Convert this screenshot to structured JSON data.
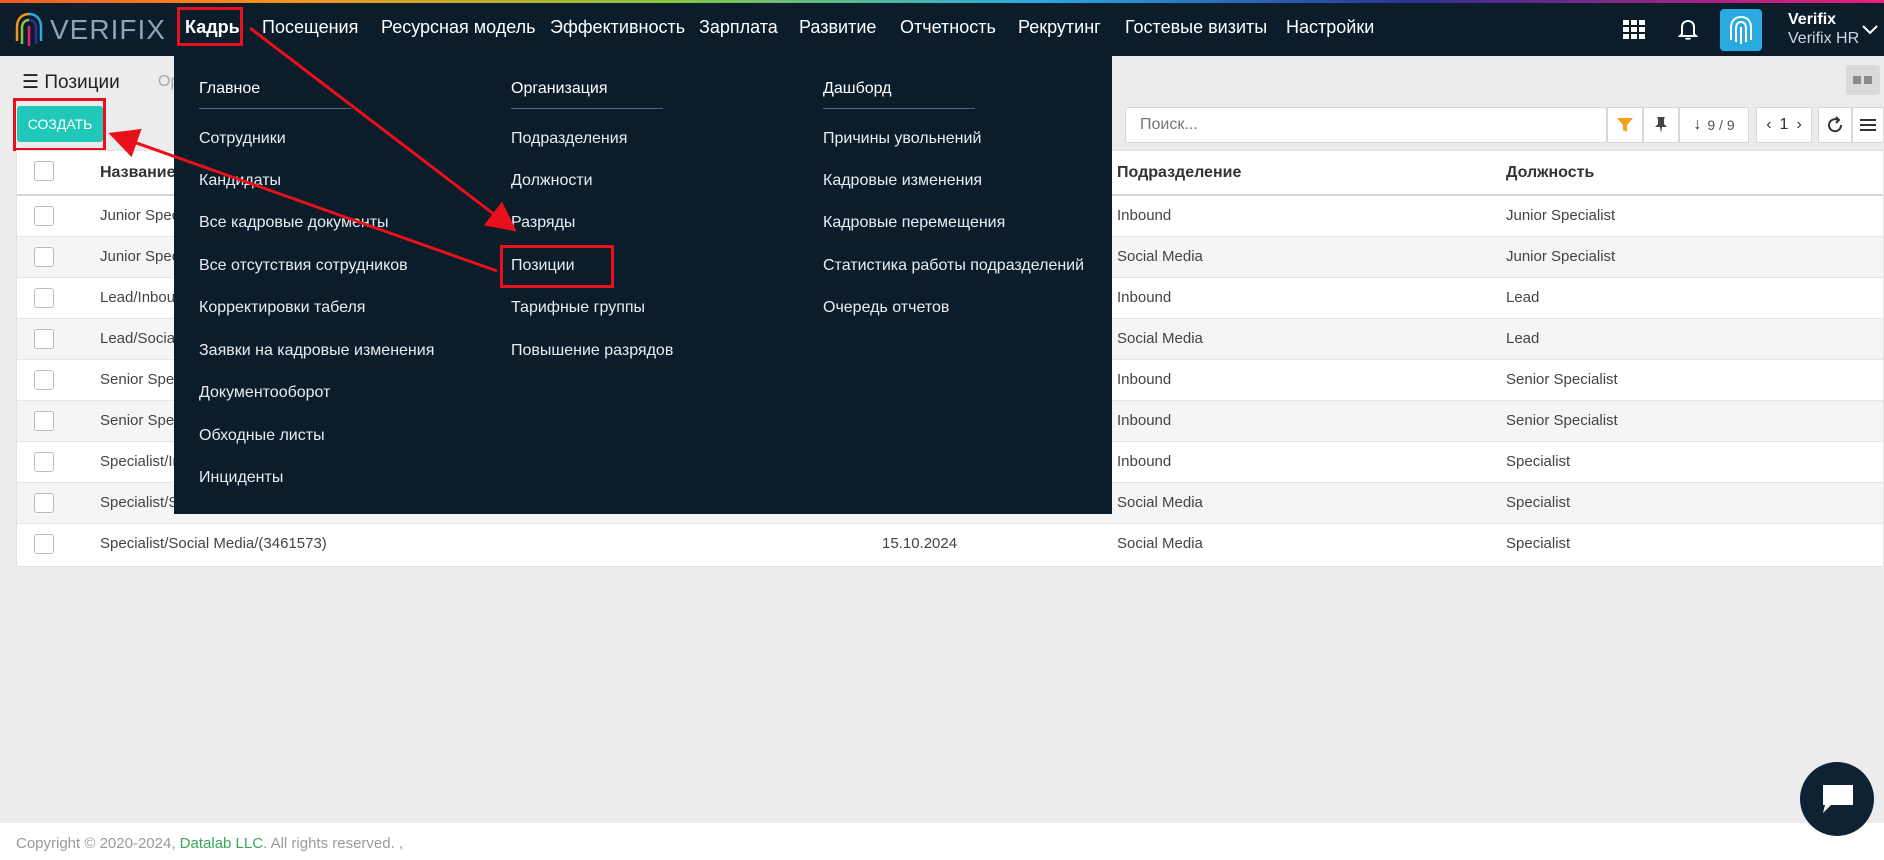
{
  "brand": {
    "name": "VERIFIX"
  },
  "nav": {
    "items": [
      "Кадры",
      "Посещения",
      "Ресурсная модель",
      "Эффективность",
      "Зарплата",
      "Развитие",
      "Отчетность",
      "Рекрутинг",
      "Гостевые визиты",
      "Настройки"
    ],
    "user_name": "Verifix",
    "user_company": "Verifix HR",
    "icons": [
      "apps-grid-icon",
      "bell-icon",
      "fingerprint-icon",
      "chevron-down-icon"
    ]
  },
  "page": {
    "title": "Позиции",
    "breadcrumb_partial": "Ор"
  },
  "toolbar": {
    "create_label": "СОЗДАТЬ",
    "search_placeholder": "Поиск...",
    "record_count": "9 / 9",
    "page_number": "1"
  },
  "table": {
    "headers": {
      "name": "Название",
      "division": "Подразделение",
      "job": "Должность"
    },
    "rows": [
      {
        "name": "Junior Spec",
        "date": "",
        "division": "Inbound",
        "job": "Junior Specialist"
      },
      {
        "name": "Junior Spec",
        "date": "",
        "division": "Social Media",
        "job": "Junior Specialist"
      },
      {
        "name": "Lead/Inbou",
        "date": "",
        "division": "Inbound",
        "job": "Lead"
      },
      {
        "name": "Lead/Social",
        "date": "",
        "division": "Social Media",
        "job": "Lead"
      },
      {
        "name": "Senior Spec",
        "date": "",
        "division": "Inbound",
        "job": "Senior Specialist"
      },
      {
        "name": "Senior Spec",
        "date": "",
        "division": "Inbound",
        "job": "Senior Specialist"
      },
      {
        "name": "Specialist/In",
        "date": "",
        "division": "Inbound",
        "job": "Specialist"
      },
      {
        "name": "Specialist/S",
        "date": "",
        "division": "Social Media",
        "job": "Specialist"
      },
      {
        "name": "Specialist/Social Media/(3461573)",
        "date": "15.10.2024",
        "division": "Social Media",
        "job": "Specialist"
      }
    ]
  },
  "megamenu": {
    "columns": [
      {
        "title": "Главное",
        "items": [
          "Сотрудники",
          "Кандидаты",
          "Все кадровые документы",
          "Все отсутствия сотрудников",
          "Корректировки табеля",
          "Заявки на кадровые изменения",
          "Документооборот",
          "Обходные листы",
          "Инциденты"
        ]
      },
      {
        "title": "Организация",
        "items": [
          "Подразделения",
          "Должности",
          "Разряды",
          "Позиции",
          "Тарифные группы",
          "Повышение разрядов"
        ]
      },
      {
        "title": "Дашборд",
        "items": [
          "Причины увольнений",
          "Кадровые изменения",
          "Кадровые перемещения",
          "Статистика работы подразделений",
          "Очередь отчетов"
        ]
      }
    ]
  },
  "footer": {
    "copyright": "Copyright © 2020-2024,",
    "company": "Datalab LLC",
    "rights": ". All rights reserved. ,"
  },
  "colors": {
    "navbar": "#0b1d2b",
    "accent": "#1fc8b8",
    "highlight": "#e8101a",
    "footer_link": "#3aa757"
  }
}
